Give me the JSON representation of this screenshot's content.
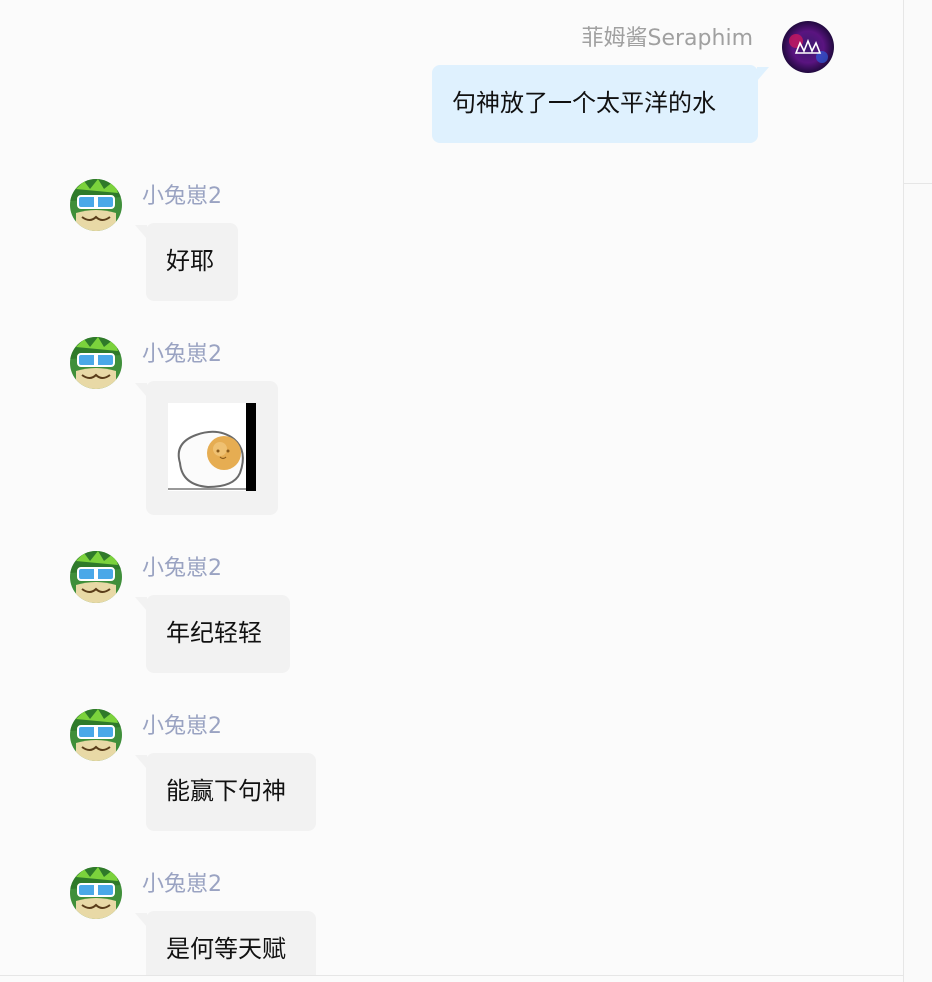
{
  "self_message": {
    "sender": "菲姆酱Seraphim",
    "text": "句神放了一个太平洋的水",
    "avatar_icon": "crown-avatar-icon"
  },
  "messages": [
    {
      "sender": "小兔崽2",
      "text": "好耶",
      "type": "text"
    },
    {
      "sender": "小兔崽2",
      "text": "",
      "type": "sticker",
      "sticker_icon": "fried-egg-sticker-icon"
    },
    {
      "sender": "小兔崽2",
      "text": "年纪轻轻",
      "type": "text"
    },
    {
      "sender": "小兔崽2",
      "text": "能赢下句神",
      "type": "text"
    },
    {
      "sender": "小兔崽2",
      "text": "是何等天赋",
      "type": "text"
    }
  ],
  "colors": {
    "self_bubble": "#dff1fe",
    "other_bubble": "#f2f2f2",
    "other_name": "#9aa3c2",
    "self_name": "#a0a0a0"
  }
}
